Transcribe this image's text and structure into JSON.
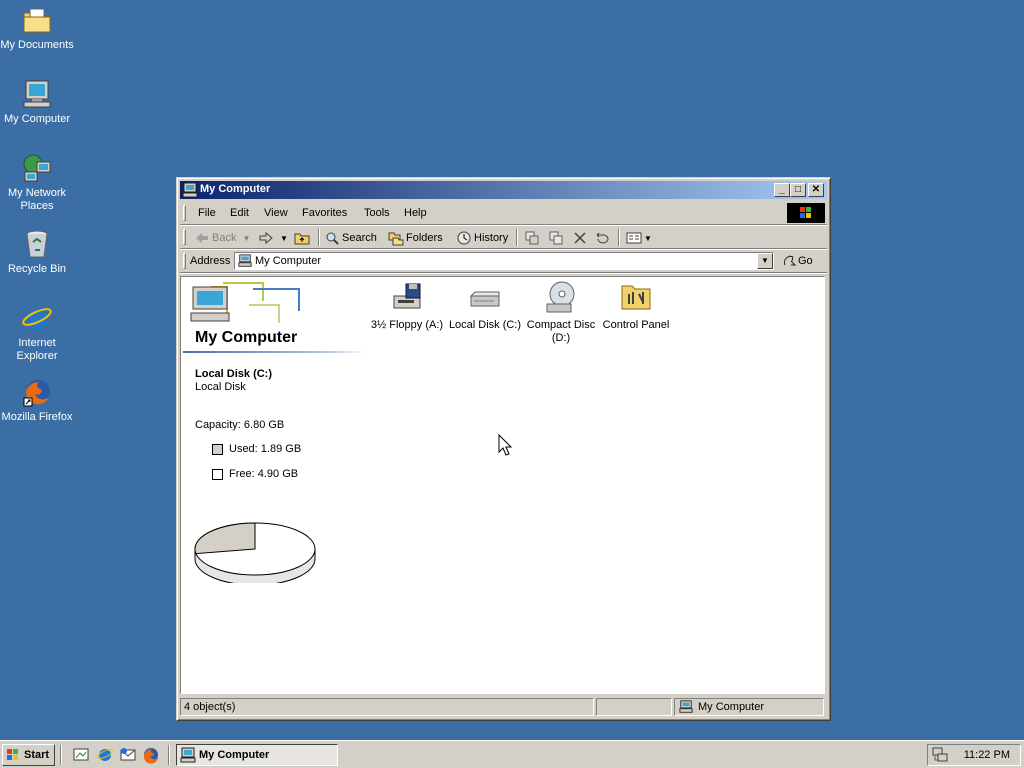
{
  "desktop": {
    "icons": [
      {
        "label": "My Documents",
        "icon": "folder-documents-icon"
      },
      {
        "label": "My Computer",
        "icon": "computer-icon"
      },
      {
        "label": "My Network Places",
        "icon": "network-icon"
      },
      {
        "label": "Recycle Bin",
        "icon": "recycle-bin-icon"
      },
      {
        "label": "Internet Explorer",
        "icon": "ie-icon"
      },
      {
        "label": "Mozilla Firefox",
        "icon": "firefox-icon"
      }
    ]
  },
  "window": {
    "title": "My Computer",
    "menu": [
      "File",
      "Edit",
      "View",
      "Favorites",
      "Tools",
      "Help"
    ],
    "toolbar": {
      "back": "Back",
      "search": "Search",
      "folders": "Folders",
      "history": "History"
    },
    "address": {
      "label": "Address",
      "value": "My Computer",
      "go": "Go"
    },
    "panel": {
      "title": "My Computer",
      "selected_name": "Local Disk (C:)",
      "selected_type": "Local Disk",
      "capacity": "Capacity: 6.80 GB",
      "used": "Used: 1.89 GB",
      "free": "Free: 4.90 GB",
      "used_fraction": 0.278
    },
    "items": [
      {
        "label": "3½ Floppy (A:)",
        "icon": "floppy-drive-icon"
      },
      {
        "label": "Local Disk (C:)",
        "icon": "hard-disk-icon"
      },
      {
        "label": "Compact Disc (D:)",
        "icon": "cd-drive-icon"
      },
      {
        "label": "Control Panel",
        "icon": "control-panel-icon"
      }
    ],
    "status": {
      "count": "4 object(s)",
      "location": "My Computer"
    }
  },
  "taskbar": {
    "start": "Start",
    "task": "My Computer",
    "clock": "11:22 PM"
  },
  "colors": {
    "desktop": "#3A6EA5",
    "title_active_start": "#0A246A",
    "title_active_end": "#A6CAF0",
    "face": "#D4D0C8"
  }
}
